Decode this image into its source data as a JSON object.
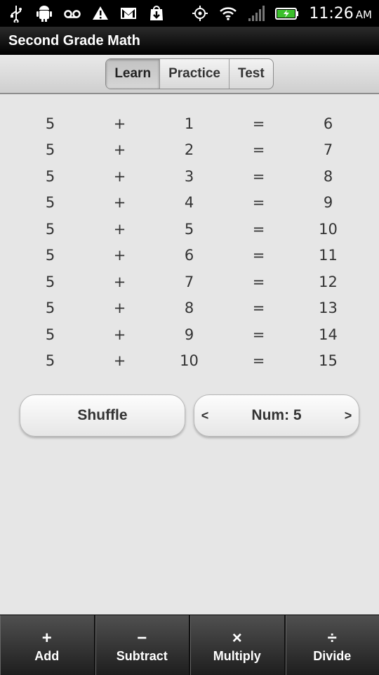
{
  "status_bar": {
    "left_icons": [
      "usb-icon",
      "android-debug-icon",
      "voicemail-icon",
      "warning-icon",
      "gmail-icon",
      "download-icon"
    ],
    "right_icons": [
      "gps-icon",
      "wifi-icon",
      "signal-icon",
      "battery-charging-icon"
    ],
    "time": "11:26",
    "ampm": "AM"
  },
  "app": {
    "title": "Second Grade Math"
  },
  "segments": [
    {
      "label": "Learn",
      "active": true
    },
    {
      "label": "Practice",
      "active": false
    },
    {
      "label": "Test",
      "active": false
    }
  ],
  "table": {
    "rows": [
      [
        "5",
        "+",
        "1",
        "=",
        "6"
      ],
      [
        "5",
        "+",
        "2",
        "=",
        "7"
      ],
      [
        "5",
        "+",
        "3",
        "=",
        "8"
      ],
      [
        "5",
        "+",
        "4",
        "=",
        "9"
      ],
      [
        "5",
        "+",
        "5",
        "=",
        "10"
      ],
      [
        "5",
        "+",
        "6",
        "=",
        "11"
      ],
      [
        "5",
        "+",
        "7",
        "=",
        "12"
      ],
      [
        "5",
        "+",
        "8",
        "=",
        "13"
      ],
      [
        "5",
        "+",
        "9",
        "=",
        "14"
      ],
      [
        "5",
        "+",
        "10",
        "=",
        "15"
      ]
    ]
  },
  "controls": {
    "shuffle_label": "Shuffle",
    "num_label": "Num: 5",
    "prev_label": "<",
    "next_label": ">"
  },
  "tabs": [
    {
      "icon": "+",
      "label": "Add",
      "name": "add"
    },
    {
      "icon": "−",
      "label": "Subtract",
      "name": "subtract"
    },
    {
      "icon": "×",
      "label": "Multiply",
      "name": "multiply"
    },
    {
      "icon": "÷",
      "label": "Divide",
      "name": "divide"
    }
  ],
  "colors": {
    "background": "#e6e6e6",
    "status_bar": "#000000",
    "battery_fill": "#3bbf2b",
    "text": "#333333"
  }
}
